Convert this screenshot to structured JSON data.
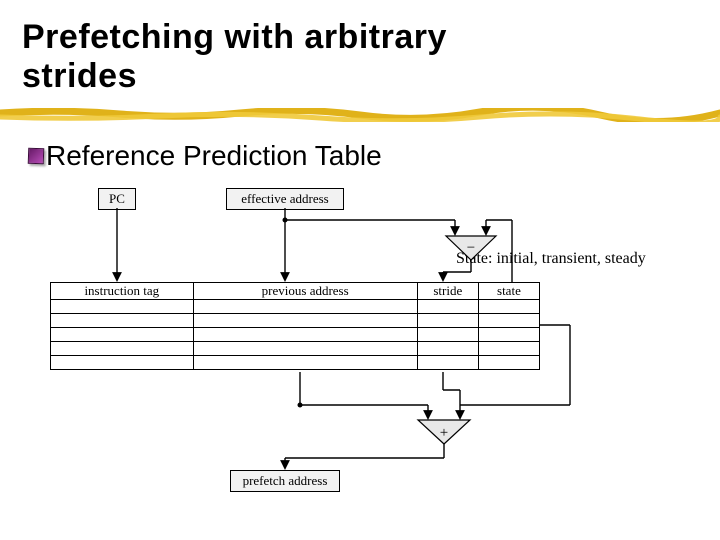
{
  "title_line1": "Prefetching with arbitrary",
  "title_line2": "strides",
  "bullet": "Reference Prediction Table",
  "annotation": "State: initial, transient, steady",
  "boxes": {
    "pc": "PC",
    "ea": "effective address",
    "prefetch": "prefetch address"
  },
  "table_headers": {
    "c1": "instruction tag",
    "c2": "previous address",
    "c3": "stride",
    "c4": "state"
  },
  "ops": {
    "minus": "−",
    "plus": "+"
  }
}
